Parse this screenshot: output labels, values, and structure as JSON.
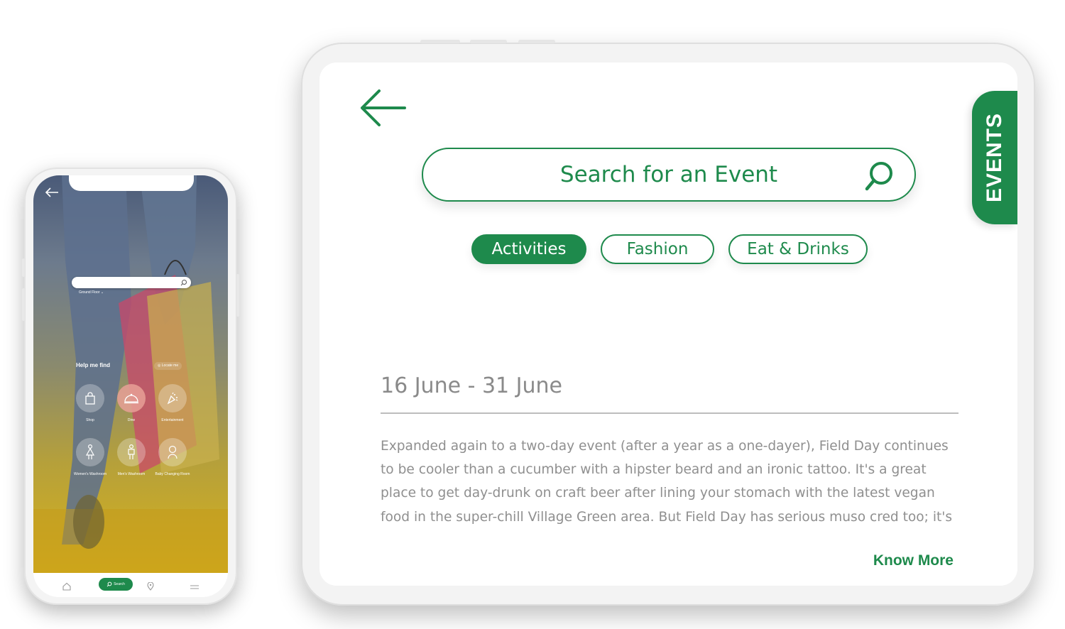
{
  "colors": {
    "accent": "#1e8a4c",
    "text_muted": "#8f8f8f"
  },
  "phone": {
    "search_placeholder": "",
    "floor_selector": "Ground Floor",
    "help_title": "Help me find",
    "locate_label": "Locate me",
    "categories": [
      {
        "label": "Shop",
        "icon": "shopping-bag-icon",
        "active": false
      },
      {
        "label": "Dine",
        "icon": "cloche-icon",
        "active": true
      },
      {
        "label": "Entertainment",
        "icon": "party-icon",
        "active": false
      },
      {
        "label": "Women's Washroom",
        "icon": "woman-icon",
        "active": false
      },
      {
        "label": "Men's Washroom",
        "icon": "man-icon",
        "active": false
      },
      {
        "label": "Baby Changing Room",
        "icon": "baby-icon",
        "active": false
      }
    ],
    "nav": {
      "search_label": "Search"
    }
  },
  "tablet": {
    "search_placeholder": "Search for an Event",
    "chips": [
      {
        "label": "Activities",
        "active": true
      },
      {
        "label": "Fashion",
        "active": false
      },
      {
        "label": "Eat & Drinks",
        "active": false
      }
    ],
    "side_tab": "EVENTS",
    "event": {
      "date": "16 June - 31 June",
      "description": "Expanded again to a two-day event (after a year as a one-dayer), Field Day continues to be cooler than a cucumber with a hipster beard and an ironic tattoo. It's a great place to get day-drunk on craft beer after lining your stomach with the latest vegan food in the super-chill Village Green area. But Field Day has serious muso cred too; it's",
      "more_label": "Know More"
    }
  }
}
